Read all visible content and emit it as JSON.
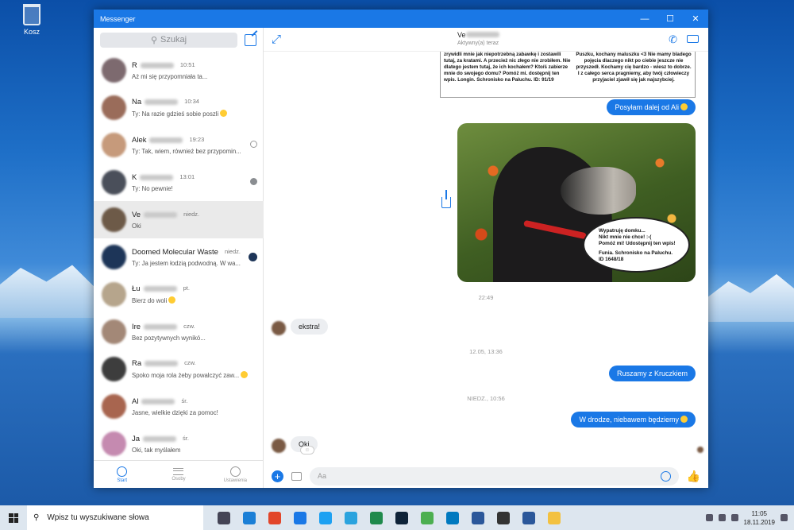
{
  "desktop": {
    "recycle_label": "Kosz"
  },
  "window": {
    "title": "Messenger",
    "min": "—",
    "max": "☐",
    "close": "✕"
  },
  "sidebar": {
    "search_placeholder": "Szukaj",
    "conversations": [
      {
        "name": "R",
        "time": "10:51",
        "msg": "Aż mi się przypomniała ta...",
        "avatar": "#7d6a6f",
        "status": "",
        "selected": false
      },
      {
        "name": "Na",
        "time": "10:34",
        "msg": "Ty: Na razie gdzieś sobie poszli",
        "avatar": "#9a6c5a",
        "status": "emoji",
        "selected": false
      },
      {
        "name": "Alek",
        "time": "19:23",
        "msg": "Ty: Tak, wiem, również bez przypomin...",
        "avatar": "#c69a7b",
        "status": "read",
        "selected": false
      },
      {
        "name": "K",
        "time": "13:01",
        "msg": "Ty: No pewnie!",
        "avatar": "#4a4f5a",
        "status": "readfill",
        "selected": false
      },
      {
        "name": "Ve",
        "time": "niedz.",
        "msg": "Oki",
        "avatar": "#6d5a48",
        "status": "",
        "selected": true
      },
      {
        "name": "Doomed Molecular Waste",
        "time": "niedz.",
        "msg": "Ty: Ja jestem łodzią podwodną. W wa...",
        "avatar": "#1d3558",
        "status": "avatar",
        "selected": false
      },
      {
        "name": "Łu",
        "time": "pt.",
        "msg": "Bierz do woli",
        "avatar": "#b6a58c",
        "status": "",
        "selected": false
      },
      {
        "name": "Ire",
        "time": "czw.",
        "msg": "Bez pozytywnych wynikó...",
        "avatar": "#a38877",
        "status": "",
        "selected": false
      },
      {
        "name": "Ra",
        "time": "czw.",
        "msg": "Spoko moja rola żeby powalczyć zaw...",
        "avatar": "#3d3d3d",
        "status": "",
        "selected": false
      },
      {
        "name": "Al",
        "time": "śr.",
        "msg": "Jasne, wielkie dzięki za pomoc!",
        "avatar": "#a8654f",
        "status": "",
        "selected": false
      },
      {
        "name": "Ja",
        "time": "śr.",
        "msg": "Oki, tak myślałem",
        "avatar": "#c58ab0",
        "status": "",
        "selected": false
      }
    ],
    "nav": [
      {
        "label": "Start"
      },
      {
        "label": "Osoby"
      },
      {
        "label": "Ustawienia"
      }
    ]
  },
  "chat": {
    "contact_name": "Ve",
    "contact_status": "Aktywny(a) teraz",
    "image_text_left": "zrywidli mnie jak niepotrzebną zabawkę i zostawili tutaj, za kratami. A przecież nic złego nie zrobiłem. Nie dlatego jestem tutaj, że ich kochałem? Kto/ś zabierze mnie do swojego domu? Pomóż mi. dostępnij ten wpis. Longin. Schronisko na Paluchu. ID: 91/19",
    "image_text_right": "Puszku, kochany maluszku <3 Nie mamy bladego pojęcia dlaczego nikt po ciebie jeszcze nie przyszedł. Kochamy cię bardzo - wiesz to dobrze. I z całego serca pragniemy, aby twój człowieczy przyjaciel zjawił się jak najszybciej.",
    "msg1": "Posyłam dalej od Ali",
    "balloon_lines": [
      "Wypatruję domku...",
      "Nikt mnie nie chce! :-(",
      "Pomóż mi! Udostępnij ten wpis!",
      "",
      "Funia. Schronisko na Paluchu.",
      "ID 1648/18"
    ],
    "stamp1": "22:49",
    "in1": "ekstra!",
    "stamp2": "12.05, 13:36",
    "out2": "Ruszamy z Kruczkiem",
    "stamp3": "NIEDZ., 10:56",
    "out3": "W drodze, niebawem będziemy",
    "in2": "Oki",
    "input_placeholder": "Aa"
  },
  "taskbar": {
    "search_placeholder": "Wpisz tu wyszukiwane słowa",
    "apps": [
      "task-view",
      "edge",
      "office",
      "messenger",
      "twitter",
      "telegram",
      "excel-green",
      "photoshop",
      "chrome",
      "trello",
      "word",
      "mail",
      "word-blue",
      "file-explorer"
    ],
    "app_colors": [
      "#445",
      "#1b7fd6",
      "#e2462a",
      "#1a78e6",
      "#1da1f2",
      "#2aa3de",
      "#1f8a4c",
      "#0e2338",
      "#4caf50",
      "#0079bf",
      "#2b579a",
      "#333",
      "#2b579a",
      "#f3c140"
    ],
    "time": "11:05",
    "date": "18.11.2019"
  }
}
